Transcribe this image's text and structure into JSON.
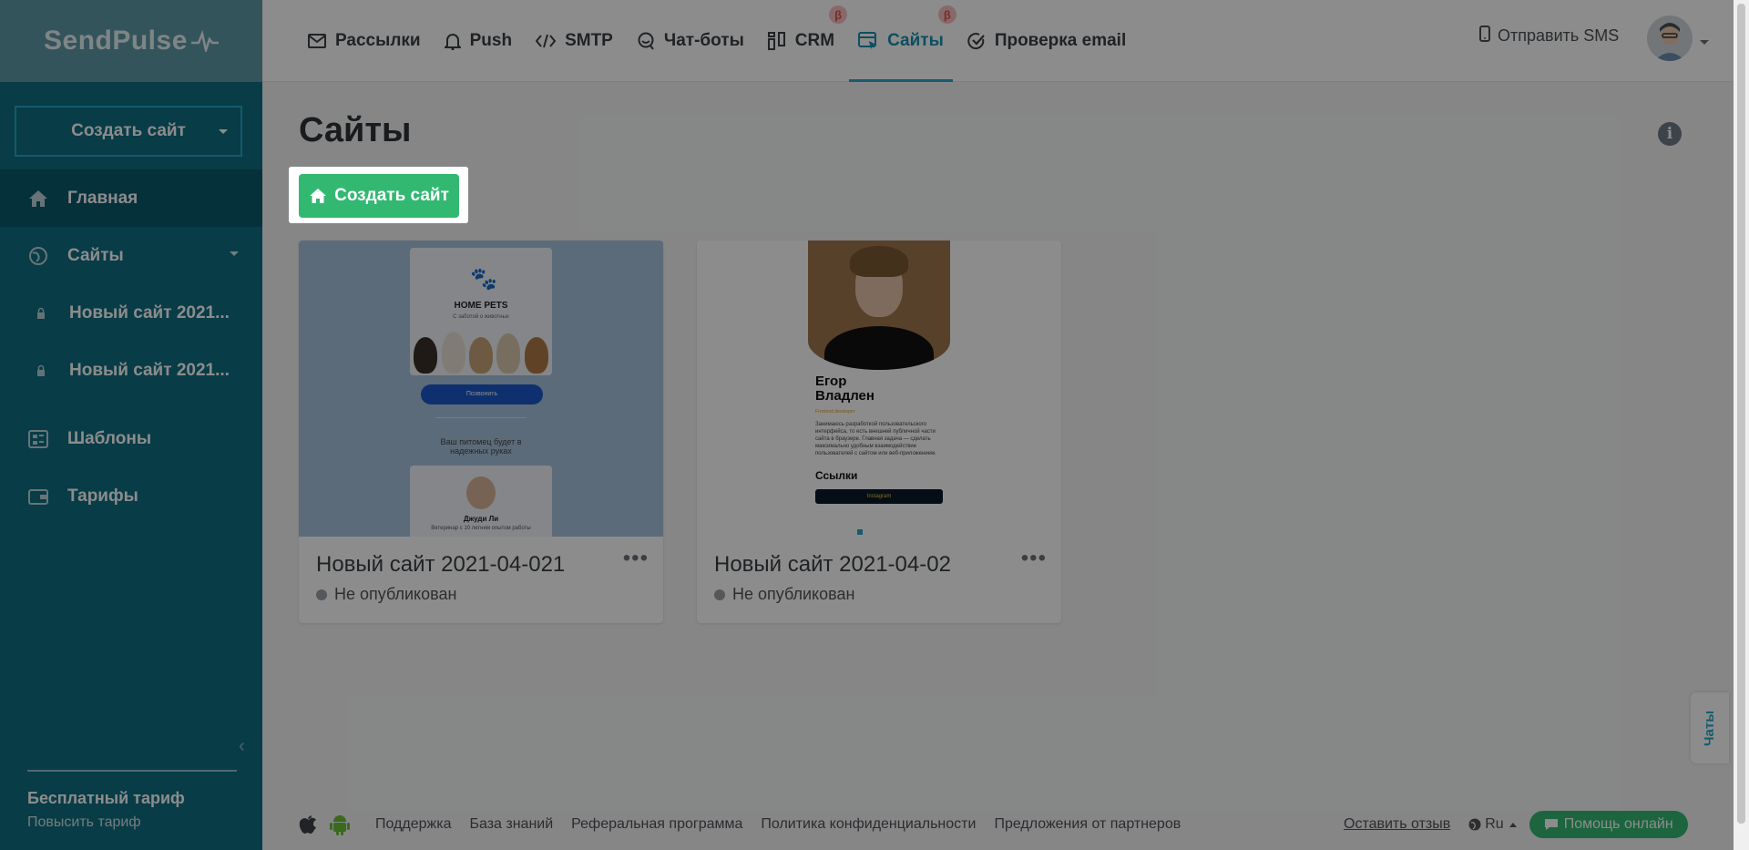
{
  "brand": {
    "logo_text": "SendPulse"
  },
  "sidebar": {
    "create_button_label": "Создать сайт",
    "items": [
      {
        "label": "Главная",
        "icon": "home-icon"
      },
      {
        "label": "Сайты",
        "icon": "globe-icon"
      },
      {
        "label": "Новый сайт 2021...",
        "icon": "lock-icon"
      },
      {
        "label": "Новый сайт 2021...",
        "icon": "lock-icon"
      },
      {
        "label": "Шаблоны",
        "icon": "templates-icon"
      },
      {
        "label": "Тарифы",
        "icon": "wallet-icon"
      }
    ],
    "plan_name": "Бесплатный тариф",
    "plan_upgrade": "Повысить тариф"
  },
  "topnav": {
    "items": [
      {
        "label": "Рассылки",
        "icon": "mail-icon"
      },
      {
        "label": "Push",
        "icon": "bell-icon"
      },
      {
        "label": "SMTP",
        "icon": "code-icon"
      },
      {
        "label": "Чат-боты",
        "icon": "chatbot-icon"
      },
      {
        "label": "CRM",
        "icon": "crm-icon",
        "beta": "β"
      },
      {
        "label": "Сайты",
        "icon": "sites-icon",
        "beta": "β",
        "active": true
      },
      {
        "label": "Проверка email",
        "icon": "check-icon"
      }
    ],
    "sms_label": "Отправить SMS"
  },
  "main": {
    "title": "Сайты",
    "create_button_label": "Создать сайт",
    "cards": [
      {
        "title": "Новый сайт 2021-04-021",
        "status": "Не опубликован",
        "preview": {
          "heading": "HOME PETS",
          "subheading": "С заботой о животных",
          "button": "Позвонить",
          "text": "Ваш питомец будет в надежных руках",
          "person_name": "Джуди Ли",
          "person_caption": "Ветеринар с 10 летним опытом работы"
        }
      },
      {
        "title": "Новый сайт 2021-04-02",
        "status": "Не опубликован",
        "preview": {
          "name_line1": "Егор",
          "name_line2": "Владлен",
          "role": "Frontend developer",
          "description": "Занимаюсь разработкой пользовательского интерфейса, то есть внешней публичной части сайта в браузере. Главная задача — сделать максимально удобным взаимодействие пользователей с сайтом или веб-приложением.",
          "links_heading": "Ссылки",
          "link_button": "Instagram"
        }
      }
    ]
  },
  "footer": {
    "links": [
      "Поддержка",
      "База знаний",
      "Реферальная программа",
      "Политика конфиденциальности",
      "Предложения от партнеров"
    ],
    "feedback": "Оставить отзыв",
    "language": "Ru",
    "help_button": "Помощь онлайн"
  },
  "chats_tab": "Чаты",
  "colors": {
    "sidebar": "#0f6e82",
    "accent": "#2aa7c9",
    "green": "#33b872"
  }
}
